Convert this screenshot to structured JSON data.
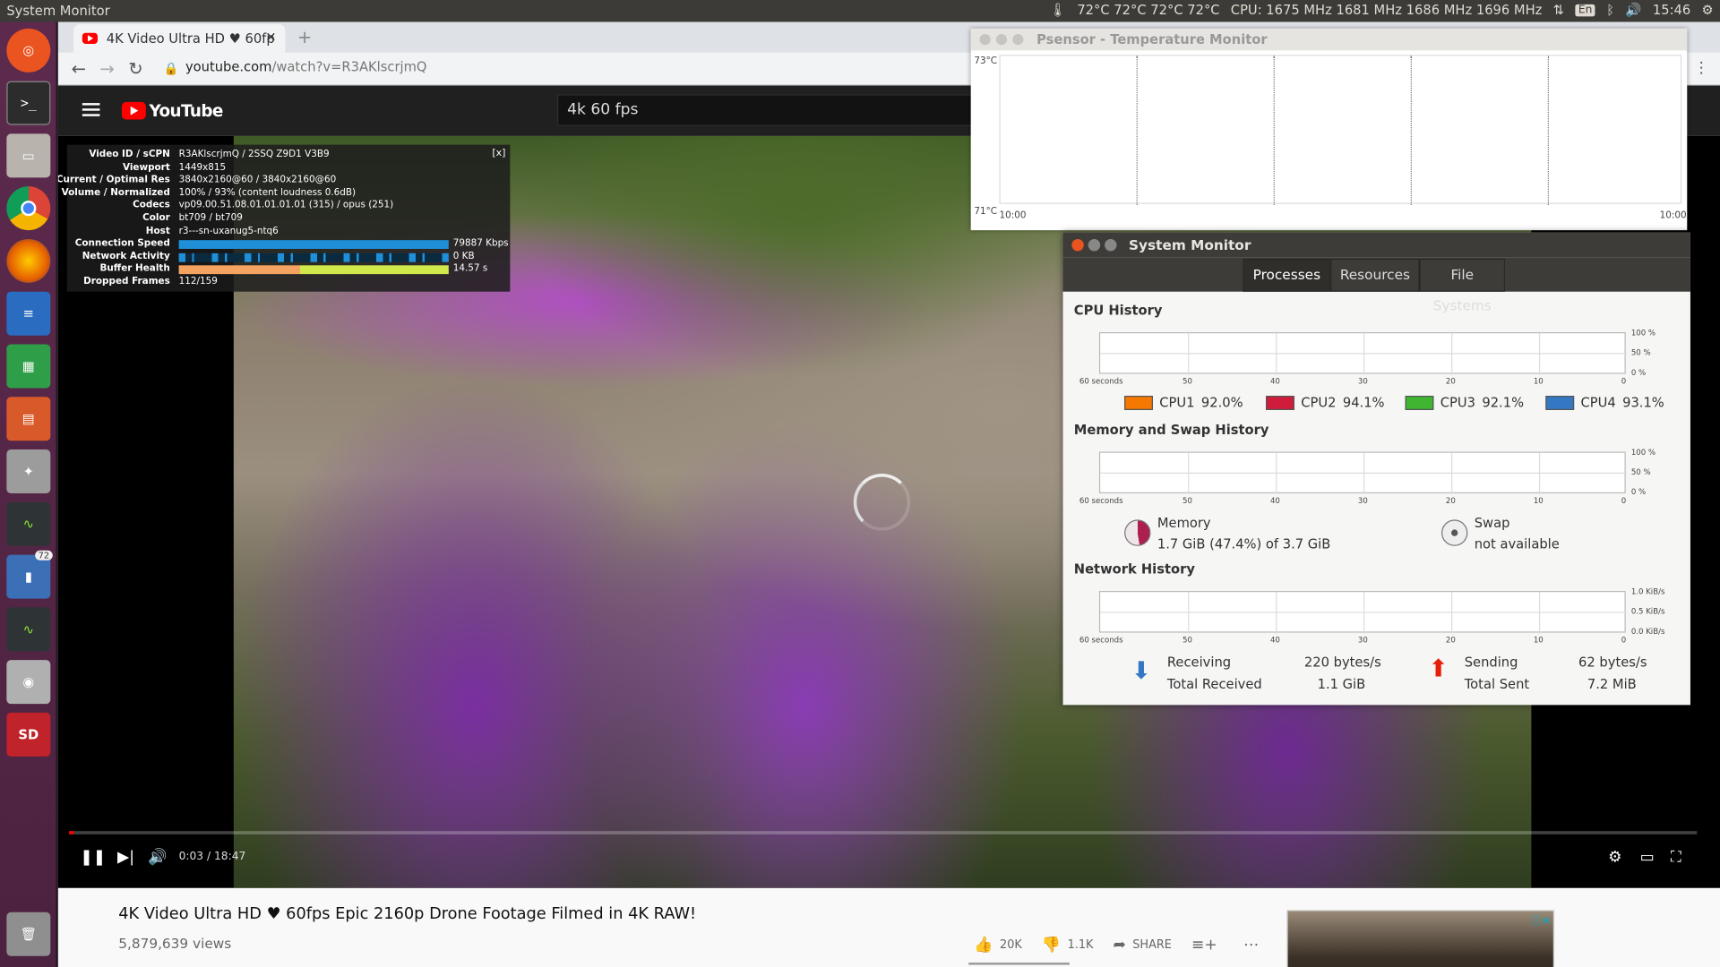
{
  "top_panel": {
    "app_name": "System Monitor",
    "temps": "72°C 72°C 72°C 72°C",
    "cpu_freq": "CPU: 1675 MHz 1681 MHz 1686 MHz 1696 MHz",
    "keyboard": "En",
    "clock": "15:46"
  },
  "launcher": {
    "badge": "72",
    "sd_label": "SD"
  },
  "browser": {
    "tab_title": "4K Video Ultra HD ♥ 60fp",
    "url_host": "youtube.com",
    "url_path": "/watch?v=R3AKlscrjmQ"
  },
  "youtube": {
    "logo_text": "YouTube",
    "search_value": "4k 60 fps",
    "stats": {
      "rows": [
        {
          "k": "Video ID / sCPN",
          "v": "R3AKlscrjmQ / 2SSQ Z9D1 V3B9"
        },
        {
          "k": "Viewport",
          "v": "1449x815"
        },
        {
          "k": "Current / Optimal Res",
          "v": "3840x2160@60 / 3840x2160@60"
        },
        {
          "k": "Volume / Normalized",
          "v": "100% / 93% (content loudness 0.6dB)"
        },
        {
          "k": "Codecs",
          "v": "vp09.00.51.08.01.01.01.01 (315) / opus (251)"
        },
        {
          "k": "Color",
          "v": "bt709 / bt709"
        },
        {
          "k": "Host",
          "v": "r3---sn-uxanug5-ntq6"
        }
      ],
      "connection_label": "Connection Speed",
      "connection_value": "79887 Kbps",
      "network_label": "Network Activity",
      "network_value": "0 KB",
      "buffer_label": "Buffer Health",
      "buffer_value": "14.57 s",
      "dropped_label": "Dropped Frames",
      "dropped_value": "112/159",
      "close": "[x]"
    },
    "time": "0:03 / 18:47",
    "progress": 0.003,
    "title": "4K Video Ultra HD ♥ 60fps Epic 2160p Drone Footage Filmed in 4K RAW!",
    "views": "5,879,639 views",
    "likes": "20K",
    "dislikes": "1.1K",
    "share": "SHARE"
  },
  "psensor": {
    "title": "Psensor - Temperature Monitor",
    "y_top": "73°C",
    "y_bottom": "71°C",
    "x_left": "10:00",
    "x_right": "10:00"
  },
  "sysmon": {
    "title": "System Monitor",
    "tabs": [
      "Processes",
      "Resources",
      "File Systems"
    ],
    "active_tab": 0,
    "cpu_section": "CPU History",
    "mem_section": "Memory and Swap History",
    "net_section": "Network History",
    "x_axis": [
      "60 seconds",
      "50",
      "40",
      "30",
      "20",
      "10",
      "0"
    ],
    "pct_axis": [
      "100 %",
      "50 %",
      "0 %"
    ],
    "net_axis": [
      "1.0 KiB/s",
      "0.5 KiB/s",
      "0.0 KiB/s"
    ],
    "cpus": [
      {
        "label": "CPU1",
        "value": "92.0%",
        "color": "#f57900"
      },
      {
        "label": "CPU2",
        "value": "94.1%",
        "color": "#d01c3c"
      },
      {
        "label": "CPU3",
        "value": "92.1%",
        "color": "#3fb531"
      },
      {
        "label": "CPU4",
        "value": "93.1%",
        "color": "#3478c3"
      }
    ],
    "memory_label": "Memory",
    "memory_value": "1.7 GiB (47.4%) of 3.7 GiB",
    "memory_fraction": 0.474,
    "swap_label": "Swap",
    "swap_value": "not available",
    "receiving_label": "Receiving",
    "receiving_value": "220 bytes/s",
    "total_received_label": "Total Received",
    "total_received_value": "1.1 GiB",
    "sending_label": "Sending",
    "sending_value": "62 bytes/s",
    "total_sent_label": "Total Sent",
    "total_sent_value": "7.2 MiB"
  }
}
